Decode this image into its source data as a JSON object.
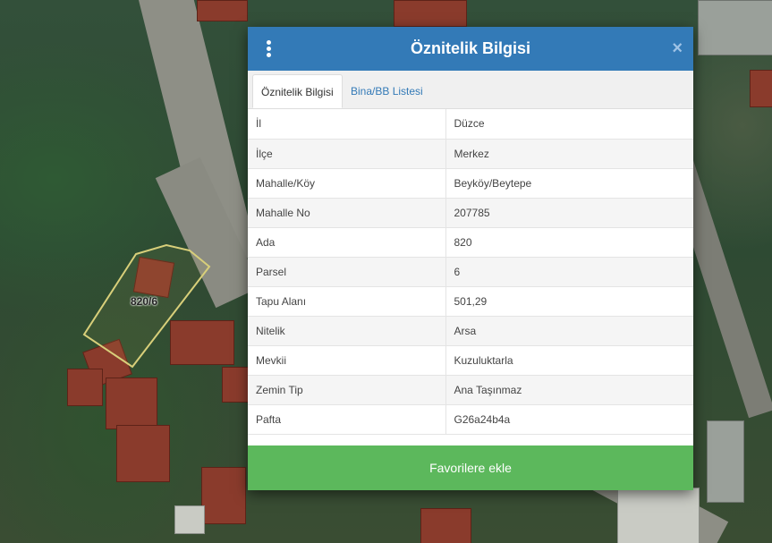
{
  "map": {
    "parcel_label": "820/6"
  },
  "dialog": {
    "title": "Öznitelik Bilgisi",
    "menu_icon": "vertical-ellipsis",
    "close_symbol": "×",
    "header_color": "#337ab7",
    "tabs": [
      {
        "label": "Öznitelik Bilgisi",
        "active": true
      },
      {
        "label": "Bina/BB Listesi",
        "active": false
      }
    ],
    "rows": [
      {
        "key": "İl",
        "value": "Düzce"
      },
      {
        "key": "İlçe",
        "value": "Merkez"
      },
      {
        "key": "Mahalle/Köy",
        "value": "Beyköy/Beytepe"
      },
      {
        "key": "Mahalle No",
        "value": "207785"
      },
      {
        "key": "Ada",
        "value": "820"
      },
      {
        "key": "Parsel",
        "value": "6"
      },
      {
        "key": "Tapu Alanı",
        "value": "501,29"
      },
      {
        "key": "Nitelik",
        "value": "Arsa"
      },
      {
        "key": "Mevkii",
        "value": "Kuzuluktarla"
      },
      {
        "key": "Zemin Tip",
        "value": "Ana Taşınmaz"
      },
      {
        "key": "Pafta",
        "value": "G26a24b4a"
      }
    ],
    "favorite_button": "Favorilere ekle",
    "favorite_color": "#5cb85c"
  }
}
